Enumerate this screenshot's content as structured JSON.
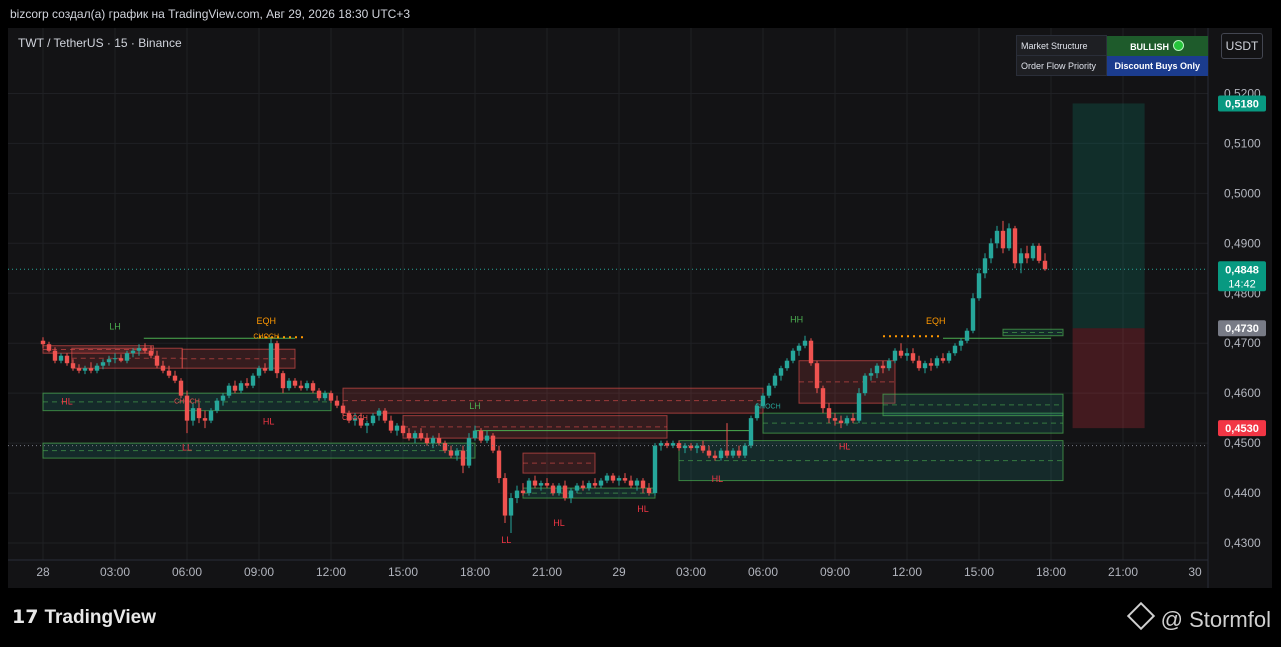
{
  "header": {
    "text": "bizcorp создал(а) график на TradingView.com, Авг 29, 2026 18:30 UTC+3"
  },
  "symbol": {
    "text": "TWT / TetherUS · 15 · Binance"
  },
  "currency_button": "USDT",
  "dashboard": {
    "row1_label": "Market Structure",
    "row1_value": "BULLISH",
    "row2_label": "Order Flow Priority",
    "row2_value": "Discount Buys Only",
    "colors": {
      "bullish": "#1e5b2b",
      "discount": "#1b3c8e"
    }
  },
  "footer": {
    "brand": "TradingView",
    "author": "@ Stormfol"
  },
  "colors": {
    "up": "#26a69a",
    "down": "#ef5350",
    "grid": "#1f2024",
    "bg": "#131315"
  },
  "chart_data": {
    "type": "candlestick",
    "x_ticks": [
      "28",
      "03:00",
      "06:00",
      "09:00",
      "12:00",
      "15:00",
      "18:00",
      "21:00",
      "29",
      "03:00",
      "06:00",
      "09:00",
      "12:00",
      "15:00",
      "18:00",
      "21:00",
      "30"
    ],
    "y_ticks": [
      "0,4300",
      "0,4400",
      "0,4500",
      "0,4600",
      "0,4700",
      "0,4800",
      "0,4900",
      "0,5000",
      "0,5100",
      "0,5200"
    ],
    "ylim": [
      0.424,
      0.5305
    ],
    "price_labels": [
      {
        "text": "0,5180",
        "value": 0.518,
        "color": "#089981"
      },
      {
        "text": "0,4848",
        "value": 0.4848,
        "color": "#089981",
        "sub": "14:42"
      },
      {
        "text": "0,4730",
        "value": 0.473,
        "color": "#787b86"
      },
      {
        "text": "0,4530",
        "value": 0.453,
        "color": "#f23645"
      }
    ],
    "position": {
      "entry": 0.473,
      "target": 0.518,
      "stop": 0.453,
      "start_hour": 42.9,
      "end_hour": 45.9
    },
    "structure_labels": [
      {
        "text": "LH",
        "t": 3.0,
        "p": 0.4735,
        "color": "#4caf50"
      },
      {
        "text": "EQH",
        "t": 9.3,
        "p": 0.4746,
        "color": "#ff9800"
      },
      {
        "text": "HL",
        "t": 1.0,
        "p": 0.4585,
        "color": "#f23645"
      },
      {
        "text": "HL",
        "t": 9.4,
        "p": 0.4545,
        "color": "#f23645"
      },
      {
        "text": "LL",
        "t": 6.0,
        "p": 0.4493,
        "color": "#f23645"
      },
      {
        "text": "LH",
        "t": 18.0,
        "p": 0.4576,
        "color": "#4caf50"
      },
      {
        "text": "LL",
        "t": 19.3,
        "p": 0.4308,
        "color": "#f23645"
      },
      {
        "text": "HL",
        "t": 21.5,
        "p": 0.4342,
        "color": "#f23645"
      },
      {
        "text": "HL",
        "t": 25.0,
        "p": 0.437,
        "color": "#f23645"
      },
      {
        "text": "HL",
        "t": 28.1,
        "p": 0.443,
        "color": "#f23645"
      },
      {
        "text": "HH",
        "t": 31.4,
        "p": 0.4749,
        "color": "#4caf50"
      },
      {
        "text": "HL",
        "t": 33.4,
        "p": 0.4495,
        "color": "#f23645"
      },
      {
        "text": "EQH",
        "t": 37.2,
        "p": 0.4746,
        "color": "#ff9800"
      }
    ],
    "small_labels": [
      {
        "text": "CHOCH",
        "t": 9.3,
        "p": 0.4715,
        "color": "#ff9800"
      },
      {
        "text": "CHOCH",
        "t": 6.0,
        "p": 0.4585,
        "color": "#ef5350"
      },
      {
        "text": "CHOCH",
        "t": 13.0,
        "p": 0.4552,
        "color": "#ef5350"
      },
      {
        "text": "CHOCH",
        "t": 30.2,
        "p": 0.4575,
        "color": "#26a69a"
      }
    ],
    "ohlc": [
      [
        0.0,
        0.4705,
        0.4712,
        0.469,
        0.4698
      ],
      [
        0.25,
        0.4698,
        0.4703,
        0.4682,
        0.4685
      ],
      [
        0.5,
        0.4685,
        0.4692,
        0.466,
        0.4665
      ],
      [
        0.75,
        0.4665,
        0.468,
        0.466,
        0.4675
      ],
      [
        1.0,
        0.4675,
        0.468,
        0.4655,
        0.466
      ],
      [
        1.25,
        0.466,
        0.4668,
        0.4645,
        0.465
      ],
      [
        1.5,
        0.465,
        0.4658,
        0.464,
        0.4645
      ],
      [
        1.75,
        0.4645,
        0.4655,
        0.4638,
        0.465
      ],
      [
        2.0,
        0.465,
        0.4662,
        0.464,
        0.4645
      ],
      [
        2.25,
        0.4645,
        0.466,
        0.464,
        0.4655
      ],
      [
        2.5,
        0.4655,
        0.4668,
        0.4648,
        0.4662
      ],
      [
        2.75,
        0.4662,
        0.4675,
        0.4655,
        0.4668
      ],
      [
        3.0,
        0.4668,
        0.468,
        0.466,
        0.467
      ],
      [
        3.25,
        0.467,
        0.4678,
        0.4662,
        0.4665
      ],
      [
        3.5,
        0.4665,
        0.4685,
        0.466,
        0.468
      ],
      [
        3.75,
        0.468,
        0.469,
        0.4672,
        0.4685
      ],
      [
        4.0,
        0.4685,
        0.4698,
        0.4675,
        0.469
      ],
      [
        4.25,
        0.469,
        0.47,
        0.468,
        0.4685
      ],
      [
        4.5,
        0.4685,
        0.4695,
        0.467,
        0.4675
      ],
      [
        4.75,
        0.4675,
        0.4685,
        0.465,
        0.4655
      ],
      [
        5.0,
        0.4655,
        0.4665,
        0.464,
        0.4645
      ],
      [
        5.25,
        0.4645,
        0.4655,
        0.463,
        0.4635
      ],
      [
        5.5,
        0.4635,
        0.4645,
        0.462,
        0.4625
      ],
      [
        5.75,
        0.4625,
        0.463,
        0.459,
        0.4595
      ],
      [
        6.0,
        0.4595,
        0.4605,
        0.452,
        0.4545
      ],
      [
        6.25,
        0.4545,
        0.458,
        0.4535,
        0.457
      ],
      [
        6.5,
        0.457,
        0.458,
        0.454,
        0.455
      ],
      [
        6.75,
        0.455,
        0.4565,
        0.453,
        0.4545
      ],
      [
        7.0,
        0.4545,
        0.457,
        0.454,
        0.4565
      ],
      [
        7.25,
        0.4565,
        0.459,
        0.456,
        0.4585
      ],
      [
        7.5,
        0.4585,
        0.46,
        0.4575,
        0.4595
      ],
      [
        7.75,
        0.4595,
        0.462,
        0.459,
        0.4615
      ],
      [
        8.0,
        0.4615,
        0.4625,
        0.46,
        0.4605
      ],
      [
        8.25,
        0.4605,
        0.4625,
        0.46,
        0.462
      ],
      [
        8.5,
        0.462,
        0.463,
        0.461,
        0.4615
      ],
      [
        8.75,
        0.4615,
        0.464,
        0.461,
        0.4635
      ],
      [
        9.0,
        0.4635,
        0.4655,
        0.463,
        0.465
      ],
      [
        9.25,
        0.465,
        0.466,
        0.464,
        0.4645
      ],
      [
        9.5,
        0.4645,
        0.4712,
        0.4645,
        0.47
      ],
      [
        9.75,
        0.47,
        0.4705,
        0.463,
        0.464
      ],
      [
        10.0,
        0.464,
        0.4645,
        0.46,
        0.461
      ],
      [
        10.25,
        0.461,
        0.463,
        0.4605,
        0.4625
      ],
      [
        10.5,
        0.4625,
        0.463,
        0.461,
        0.4615
      ],
      [
        10.75,
        0.4615,
        0.4625,
        0.4605,
        0.461
      ],
      [
        11.0,
        0.461,
        0.4625,
        0.4605,
        0.462
      ],
      [
        11.25,
        0.462,
        0.4625,
        0.46,
        0.4605
      ],
      [
        11.5,
        0.4605,
        0.461,
        0.4585,
        0.459
      ],
      [
        11.75,
        0.459,
        0.4605,
        0.4585,
        0.46
      ],
      [
        12.0,
        0.46,
        0.4605,
        0.458,
        0.4585
      ],
      [
        12.25,
        0.4585,
        0.4595,
        0.457,
        0.4575
      ],
      [
        12.5,
        0.4575,
        0.458,
        0.4555,
        0.456
      ],
      [
        12.75,
        0.456,
        0.4565,
        0.454,
        0.4545
      ],
      [
        13.0,
        0.4545,
        0.456,
        0.4535,
        0.455
      ],
      [
        13.25,
        0.455,
        0.456,
        0.453,
        0.4535
      ],
      [
        13.5,
        0.4535,
        0.4545,
        0.452,
        0.454
      ],
      [
        13.75,
        0.454,
        0.456,
        0.4535,
        0.4555
      ],
      [
        14.0,
        0.4555,
        0.457,
        0.4545,
        0.4565
      ],
      [
        14.25,
        0.4565,
        0.457,
        0.454,
        0.4545
      ],
      [
        14.5,
        0.4545,
        0.4555,
        0.452,
        0.4525
      ],
      [
        14.75,
        0.4525,
        0.454,
        0.4515,
        0.4535
      ],
      [
        15.0,
        0.4535,
        0.4545,
        0.4515,
        0.452
      ],
      [
        15.25,
        0.452,
        0.453,
        0.4505,
        0.451
      ],
      [
        15.5,
        0.451,
        0.4525,
        0.45,
        0.452
      ],
      [
        15.75,
        0.452,
        0.453,
        0.4505,
        0.451
      ],
      [
        16.0,
        0.451,
        0.452,
        0.4495,
        0.45
      ],
      [
        16.25,
        0.45,
        0.4515,
        0.449,
        0.451
      ],
      [
        16.5,
        0.451,
        0.452,
        0.4495,
        0.45
      ],
      [
        16.75,
        0.45,
        0.4505,
        0.448,
        0.4485
      ],
      [
        17.0,
        0.4485,
        0.4495,
        0.447,
        0.4475
      ],
      [
        17.25,
        0.4475,
        0.449,
        0.4465,
        0.4485
      ],
      [
        17.5,
        0.4485,
        0.4495,
        0.444,
        0.4455
      ],
      [
        17.75,
        0.4455,
        0.452,
        0.445,
        0.451
      ],
      [
        18.0,
        0.451,
        0.4535,
        0.4505,
        0.4525
      ],
      [
        18.25,
        0.4525,
        0.453,
        0.45,
        0.4505
      ],
      [
        18.5,
        0.4505,
        0.4525,
        0.45,
        0.4515
      ],
      [
        18.75,
        0.4515,
        0.452,
        0.448,
        0.4485
      ],
      [
        19.0,
        0.4485,
        0.4495,
        0.442,
        0.443
      ],
      [
        19.25,
        0.443,
        0.444,
        0.434,
        0.4355
      ],
      [
        19.5,
        0.4355,
        0.44,
        0.432,
        0.439
      ],
      [
        19.75,
        0.439,
        0.4415,
        0.438,
        0.4405
      ],
      [
        20.0,
        0.4405,
        0.442,
        0.4395,
        0.44
      ],
      [
        20.25,
        0.44,
        0.443,
        0.4395,
        0.4425
      ],
      [
        20.5,
        0.4425,
        0.4435,
        0.441,
        0.4415
      ],
      [
        20.75,
        0.4415,
        0.4425,
        0.4405,
        0.442
      ],
      [
        21.0,
        0.442,
        0.443,
        0.441,
        0.4415
      ],
      [
        21.25,
        0.4415,
        0.442,
        0.4395,
        0.44
      ],
      [
        21.5,
        0.44,
        0.442,
        0.4395,
        0.4415
      ],
      [
        21.75,
        0.4415,
        0.4425,
        0.4385,
        0.439
      ],
      [
        22.0,
        0.439,
        0.441,
        0.438,
        0.4405
      ],
      [
        22.25,
        0.4405,
        0.442,
        0.44,
        0.4415
      ],
      [
        22.5,
        0.4415,
        0.4425,
        0.4405,
        0.441
      ],
      [
        22.75,
        0.441,
        0.4425,
        0.4405,
        0.442
      ],
      [
        23.0,
        0.442,
        0.443,
        0.441,
        0.4415
      ],
      [
        23.25,
        0.4415,
        0.443,
        0.441,
        0.4425
      ],
      [
        23.5,
        0.4425,
        0.444,
        0.442,
        0.4435
      ],
      [
        23.75,
        0.4435,
        0.444,
        0.442,
        0.4425
      ],
      [
        24.0,
        0.4425,
        0.4435,
        0.4415,
        0.443
      ],
      [
        24.25,
        0.443,
        0.444,
        0.442,
        0.4425
      ],
      [
        24.5,
        0.4425,
        0.4435,
        0.441,
        0.4415
      ],
      [
        24.75,
        0.4415,
        0.443,
        0.4405,
        0.4425
      ],
      [
        25.0,
        0.4425,
        0.443,
        0.44,
        0.441
      ],
      [
        25.25,
        0.441,
        0.442,
        0.4395,
        0.44
      ],
      [
        25.5,
        0.44,
        0.45,
        0.4395,
        0.4495
      ],
      [
        25.75,
        0.4495,
        0.4505,
        0.4485,
        0.45
      ],
      [
        26.0,
        0.45,
        0.4505,
        0.449,
        0.4495
      ],
      [
        26.25,
        0.4495,
        0.4505,
        0.449,
        0.45
      ],
      [
        26.5,
        0.45,
        0.4505,
        0.4485,
        0.449
      ],
      [
        26.75,
        0.449,
        0.45,
        0.448,
        0.4495
      ],
      [
        27.0,
        0.4495,
        0.45,
        0.4485,
        0.449
      ],
      [
        27.25,
        0.449,
        0.45,
        0.448,
        0.4495
      ],
      [
        27.5,
        0.4495,
        0.4505,
        0.448,
        0.4485
      ],
      [
        27.75,
        0.4485,
        0.4495,
        0.447,
        0.4475
      ],
      [
        28.0,
        0.4475,
        0.4485,
        0.4465,
        0.447
      ],
      [
        28.25,
        0.447,
        0.449,
        0.4465,
        0.4485
      ],
      [
        28.5,
        0.4485,
        0.454,
        0.447,
        0.4475
      ],
      [
        28.75,
        0.4475,
        0.449,
        0.447,
        0.4485
      ],
      [
        29.0,
        0.4485,
        0.4495,
        0.447,
        0.4475
      ],
      [
        29.25,
        0.4475,
        0.45,
        0.447,
        0.4495
      ],
      [
        29.5,
        0.4495,
        0.4555,
        0.449,
        0.455
      ],
      [
        29.75,
        0.455,
        0.458,
        0.4545,
        0.4575
      ],
      [
        30.0,
        0.4575,
        0.46,
        0.457,
        0.4595
      ],
      [
        30.25,
        0.4595,
        0.462,
        0.459,
        0.4615
      ],
      [
        30.5,
        0.4615,
        0.464,
        0.461,
        0.4635
      ],
      [
        30.75,
        0.4635,
        0.4655,
        0.4625,
        0.465
      ],
      [
        31.0,
        0.465,
        0.467,
        0.4645,
        0.4665
      ],
      [
        31.25,
        0.4665,
        0.469,
        0.466,
        0.4685
      ],
      [
        31.5,
        0.4685,
        0.47,
        0.4675,
        0.4695
      ],
      [
        31.75,
        0.4695,
        0.4715,
        0.469,
        0.4705
      ],
      [
        32.0,
        0.4705,
        0.471,
        0.4655,
        0.466
      ],
      [
        32.25,
        0.466,
        0.4665,
        0.46,
        0.461
      ],
      [
        32.5,
        0.461,
        0.4615,
        0.456,
        0.457
      ],
      [
        32.75,
        0.457,
        0.458,
        0.454,
        0.455
      ],
      [
        33.0,
        0.455,
        0.456,
        0.4535,
        0.4545
      ],
      [
        33.25,
        0.4545,
        0.4555,
        0.453,
        0.454
      ],
      [
        33.5,
        0.454,
        0.4555,
        0.4535,
        0.455
      ],
      [
        33.75,
        0.455,
        0.456,
        0.454,
        0.4545
      ],
      [
        34.0,
        0.4545,
        0.461,
        0.454,
        0.46
      ],
      [
        34.25,
        0.46,
        0.464,
        0.4595,
        0.4635
      ],
      [
        34.5,
        0.4635,
        0.465,
        0.4625,
        0.464
      ],
      [
        34.75,
        0.464,
        0.466,
        0.463,
        0.4655
      ],
      [
        35.0,
        0.4655,
        0.4665,
        0.464,
        0.465
      ],
      [
        35.25,
        0.465,
        0.467,
        0.4645,
        0.4665
      ],
      [
        35.5,
        0.4665,
        0.469,
        0.466,
        0.4685
      ],
      [
        35.75,
        0.4685,
        0.47,
        0.467,
        0.4675
      ],
      [
        36.0,
        0.4675,
        0.469,
        0.4665,
        0.468
      ],
      [
        36.25,
        0.468,
        0.469,
        0.466,
        0.4665
      ],
      [
        36.5,
        0.4665,
        0.4675,
        0.4645,
        0.465
      ],
      [
        36.75,
        0.465,
        0.4665,
        0.464,
        0.466
      ],
      [
        37.0,
        0.466,
        0.467,
        0.4645,
        0.4655
      ],
      [
        37.25,
        0.4655,
        0.4675,
        0.465,
        0.467
      ],
      [
        37.5,
        0.467,
        0.468,
        0.466,
        0.4665
      ],
      [
        37.75,
        0.4665,
        0.4685,
        0.466,
        0.468
      ],
      [
        38.0,
        0.468,
        0.47,
        0.4675,
        0.4695
      ],
      [
        38.25,
        0.4695,
        0.471,
        0.4685,
        0.4705
      ],
      [
        38.5,
        0.4705,
        0.473,
        0.47,
        0.4725
      ],
      [
        38.75,
        0.4725,
        0.48,
        0.472,
        0.479
      ],
      [
        39.0,
        0.479,
        0.485,
        0.4785,
        0.484
      ],
      [
        39.25,
        0.484,
        0.488,
        0.483,
        0.487
      ],
      [
        39.5,
        0.487,
        0.491,
        0.486,
        0.49
      ],
      [
        39.75,
        0.49,
        0.4935,
        0.489,
        0.4925
      ],
      [
        40.0,
        0.4925,
        0.4945,
        0.488,
        0.489
      ],
      [
        40.25,
        0.489,
        0.494,
        0.4885,
        0.493
      ],
      [
        40.5,
        0.493,
        0.4935,
        0.485,
        0.486
      ],
      [
        40.75,
        0.486,
        0.489,
        0.484,
        0.488
      ],
      [
        41.0,
        0.488,
        0.4895,
        0.486,
        0.487
      ],
      [
        41.25,
        0.487,
        0.49,
        0.4865,
        0.4895
      ],
      [
        41.5,
        0.4895,
        0.49,
        0.486,
        0.4865
      ],
      [
        41.75,
        0.4865,
        0.488,
        0.4845,
        0.4848
      ]
    ]
  }
}
